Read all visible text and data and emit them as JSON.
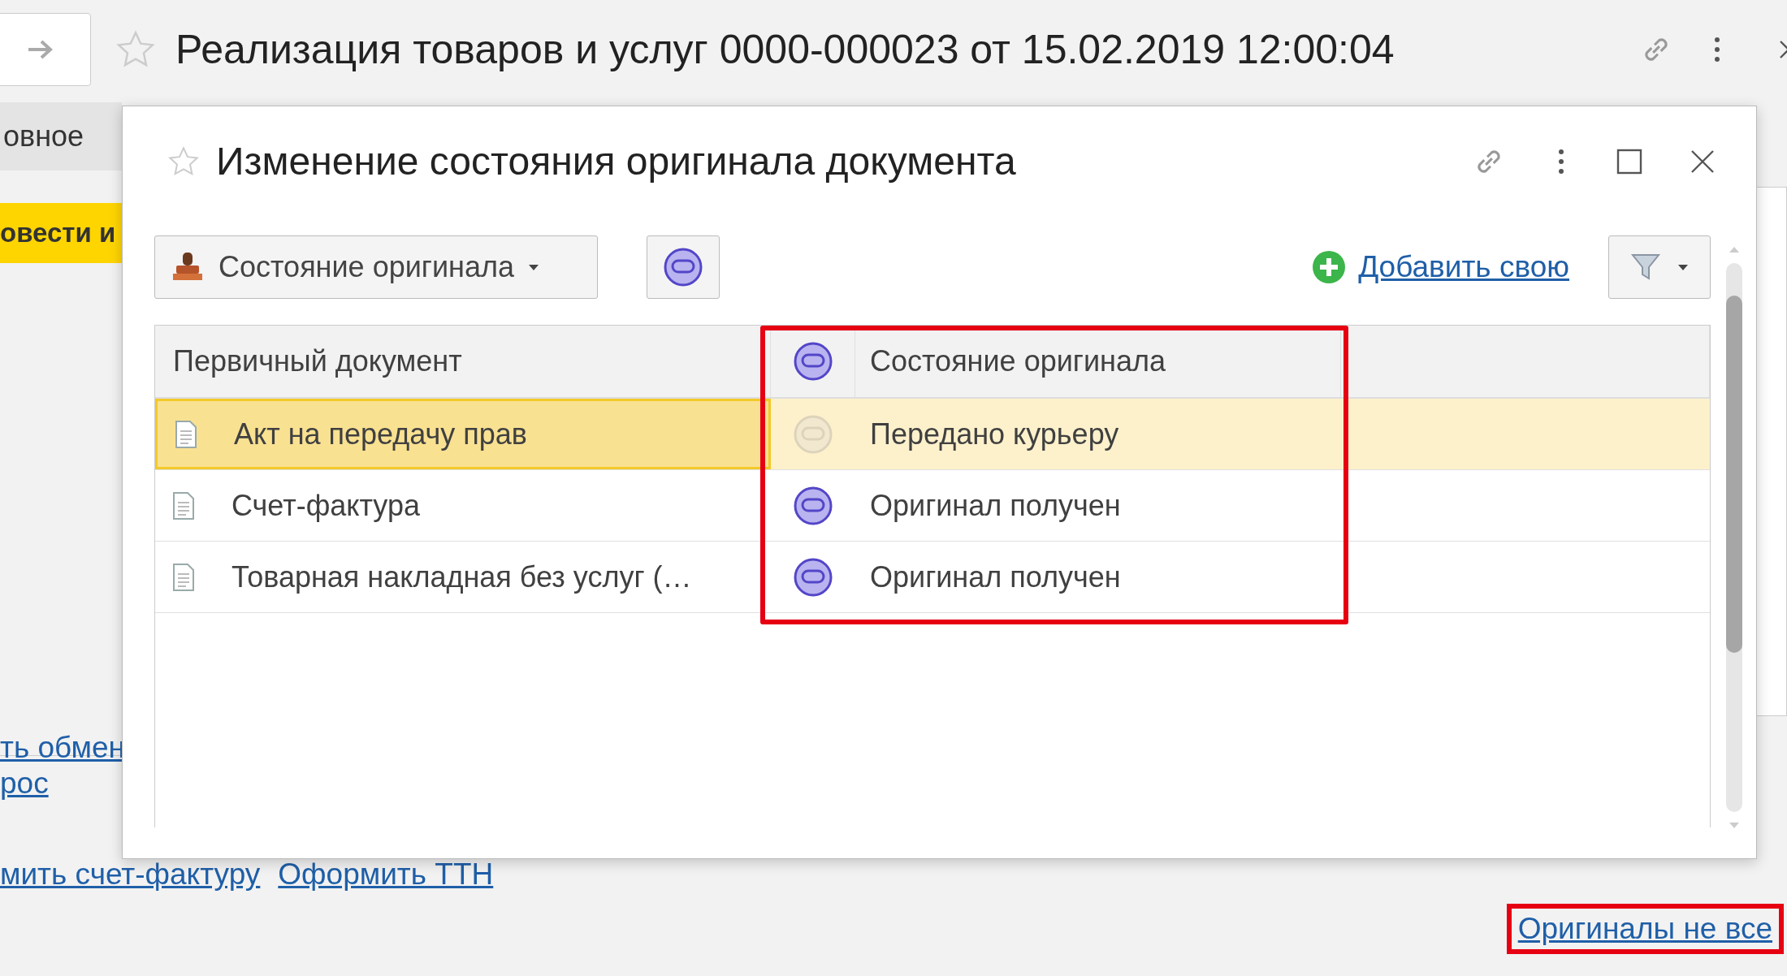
{
  "main_window": {
    "title": "Реализация товаров и услуг 0000-000023 от 15.02.2019 12:00:04",
    "tab": "овное",
    "post_button": "овести и",
    "links": [
      "ть обмен",
      "рос"
    ],
    "bottom_links": [
      "мить счет-фактуру",
      "Оформить ТТН"
    ],
    "originals_link": {
      "label": "Оригиналы не все",
      "highlighted": true
    }
  },
  "dialog": {
    "title": "Изменение состояния оригинала документа",
    "state_dropdown": "Состояние оригинала",
    "add_link": "Добавить свою",
    "table": {
      "columns": [
        "Первичный документ",
        "Состояние оригинала"
      ],
      "state_columns_highlighted": true,
      "rows": [
        {
          "document": "Акт на передачу прав",
          "state": "Передано курьеру",
          "received": false,
          "selected": true
        },
        {
          "document": "Счет-фактура",
          "state": "Оригинал получен",
          "received": true,
          "selected": false
        },
        {
          "document": "Товарная накладная без услуг (…",
          "state": "Оригинал получен",
          "received": true,
          "selected": false
        }
      ]
    }
  }
}
